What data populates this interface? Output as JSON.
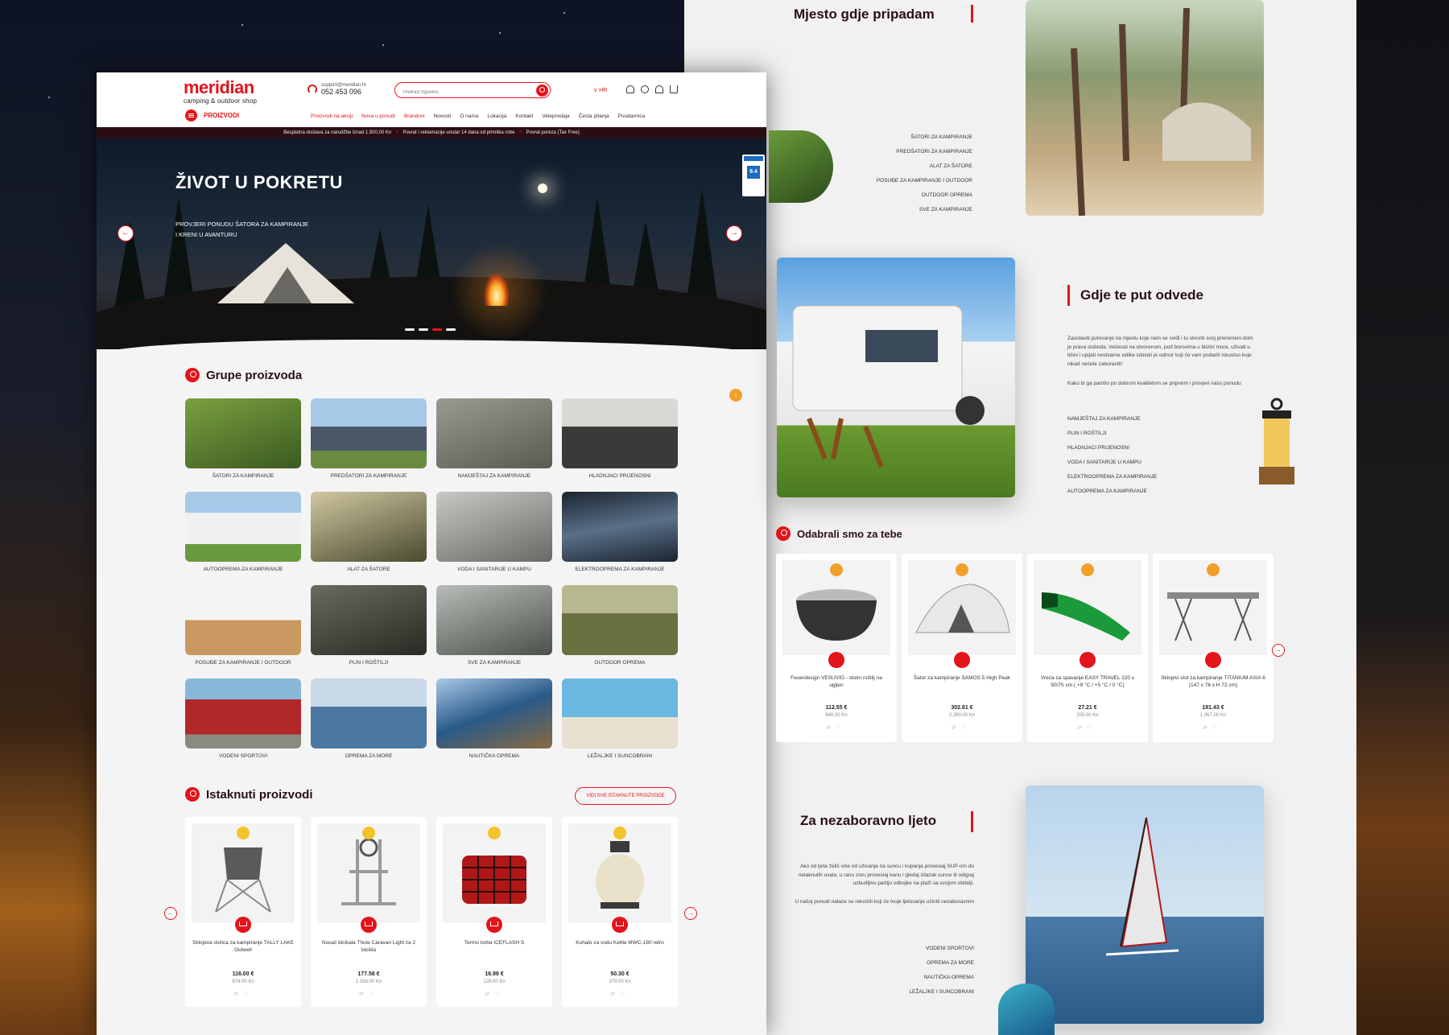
{
  "brand": {
    "name": "meridian",
    "tagline": "camping & outdoor shop"
  },
  "contact": {
    "email": "support@meridian.hr",
    "phone": "052 453 096"
  },
  "search": {
    "placeholder": "Pretraži trgovinu"
  },
  "language": "HR",
  "menu_label": "PROIZVODI",
  "nav": [
    "Proizvodi na akciji",
    "Nova u ponudi",
    "Brandovi",
    "Novosti",
    "O nama",
    "Lokacija",
    "Kontakt",
    "Veleprodaja",
    "Česta pitanja",
    "Posdavnica"
  ],
  "infobar": [
    "Besplatna dostava za narudžbe iznad 1.500,00 Kn",
    "Povrat i reklamacije unutar 14 dana od primitka robe",
    "Povrat poreza (Tax Free)"
  ],
  "hero": {
    "title": "ŽIVOT U POKRETU",
    "subtitle_line1": "PROVJERI PONUDU ŠATORA ZA KAMPIRANJE",
    "subtitle_line2": "I KRENI U AVANTURU",
    "prev": "←",
    "next": "→",
    "badge_score": "9.4"
  },
  "groups": {
    "title": "Grupe proizvoda",
    "items": [
      {
        "label": "ŠATORI ZA KAMPIRANJE",
        "color": "#4a6a2a"
      },
      {
        "label": "PREDŠATORI ZA KAMPIRANJE",
        "color": "#5a7088"
      },
      {
        "label": "NAMJEŠTAJ ZA KAMPIRANJE",
        "color": "#7a7a70"
      },
      {
        "label": "HLADNJACI PRIJENOSNI",
        "color": "#5a5a58"
      },
      {
        "label": "AUTOOPREMA ZA KAMPIRANJE",
        "color": "#6a88a8"
      },
      {
        "label": "ALAT ZA ŠATORE",
        "color": "#5a5a40"
      },
      {
        "label": "VODA I SANITARIJE U KAMPU",
        "color": "#8a8884"
      },
      {
        "label": "ELEKTROOPREMA ZA KAMPIRANJE",
        "color": "#2a3440"
      },
      {
        "label": "POSUĐE ZA KAMPIRANJE I OUTDOOR",
        "color": "#c8a070"
      },
      {
        "label": "PLIN I ROŠTILJI",
        "color": "#4a4a40"
      },
      {
        "label": "SVE ZA KAMPIRANJE",
        "color": "#6a7068"
      },
      {
        "label": "OUTDOOR OPREMA",
        "color": "#8a8050"
      },
      {
        "label": "VODENI SPORTOVI",
        "color": "#a03030"
      },
      {
        "label": "OPREMA ZA MORE",
        "color": "#6a90b0"
      },
      {
        "label": "NAUTIČKA OPREMA",
        "color": "#3a6a98"
      },
      {
        "label": "LEŽALJKE I SUNCOBRANI",
        "color": "#4aa0c8"
      }
    ]
  },
  "up_arrow": "↑",
  "featured": {
    "title": "Istaknuti proizvodi",
    "view_all": "VIDI SVE ISTAKNUTE PROIZVODE",
    "prev": "←",
    "next": "→",
    "products": [
      {
        "name": "Sklopiva stolica za kampiranje TALLY LAKE Outwell",
        "price": "116.00 €",
        "old": "874.00 Kn"
      },
      {
        "name": "Nosač bicikala Thule Caravan Light za 2 bicikla",
        "price": "177.58 €",
        "old": "1.338.00 Kn"
      },
      {
        "name": "Termo torba ICEFLASH S",
        "price": "16.99 €",
        "old": "128.00 Kn"
      },
      {
        "name": "Kuhalo za vodu Kettle MWC-180 retro",
        "price": "50.30 €",
        "old": "379.00 Kn"
      }
    ]
  },
  "right": {
    "top_title": "Mjesto gdje pripadam",
    "top_list": [
      "ŠATORI ZA KAMPIRANJE",
      "PREDŠATORI ZA KAMPIRANJE",
      "ALAT ZA ŠATORE",
      "POSUĐE ZA KAMPIRANJE I OUTDOOR",
      "OUTDOOR OPREMA",
      "SVE ZA KAMPIRANJE"
    ],
    "mid_title": "Gdje te put odvede",
    "mid_para1": "Zaustaviti putovanje na mjestu koje nam se sviđi i tu stvoriti svoj privremeni dom je prava sloboda. Večerati na otvorenom, pod borovima u blizini mora, uživati u tišini i upijati nestvarne vidike istinski je odmor koji će vam podariti iskustvo koje nikad nećete zaboraviti!",
    "mid_para2": "Kako bi ga pamtio po dobrom kvalitetom se pripremi i provjeri našu ponudu",
    "mid_list": [
      "NAMJEŠTAJ ZA KAMPIRANJE",
      "PLIN I ROŠTILJI",
      "HLADNJACI PRIJENOSNI",
      "VODA I SANITARIJE U KAMPU",
      "ELEKTROOPREMA ZA KAMPIRANJE",
      "AUTOOPREMA ZA KAMPIRANJE"
    ],
    "picks_title": "Odabrali smo za tebe",
    "picks": [
      {
        "name": "Feuerdesign VESUVIO - stolni roštilj na ugljen",
        "price": "112.55 €",
        "old": "848.00 Kn"
      },
      {
        "name": "Šator za kampiranje SAMOS 5 High Peak",
        "price": "302.61 €",
        "old": "2.280.00 Kn"
      },
      {
        "name": "Vreća za spavanje EASY TRAVEL 220 x 50/75 cm ( +9 °C / +5 °C / 0 °C)",
        "price": "27.21 €",
        "old": "205.00 Kn"
      },
      {
        "name": "Sklopivi stol za kampiranje TITANIUM AXIA 6 (147 x 76 x H 72 cm)",
        "price": "181.43 €",
        "old": "1.367.00 Kn"
      }
    ],
    "picks_next": "→",
    "bottom_title": "Za nezaboravno ljeto",
    "bottom_para1": "Ako od ljeta želiš više od uživanja na suncu i kupanja provesiaj SUP-om do netaknutih uvala, u ranu zoru provesiaj kanu i gledaj izlazak sunce ili odigraj uzbudljivu partiju odbojke na plaži sa svojom obitelji.",
    "bottom_para2": "U našoj ponudi nalaze se rekviziti koji će tvoje ljetovanje učiniti nezaboravnim",
    "bottom_list": [
      "VODENI SPORTOVI",
      "OPREMA ZA MORE",
      "NAUTIČKA OPREMA",
      "LEŽALJKE I SUNCOBRANI"
    ]
  }
}
